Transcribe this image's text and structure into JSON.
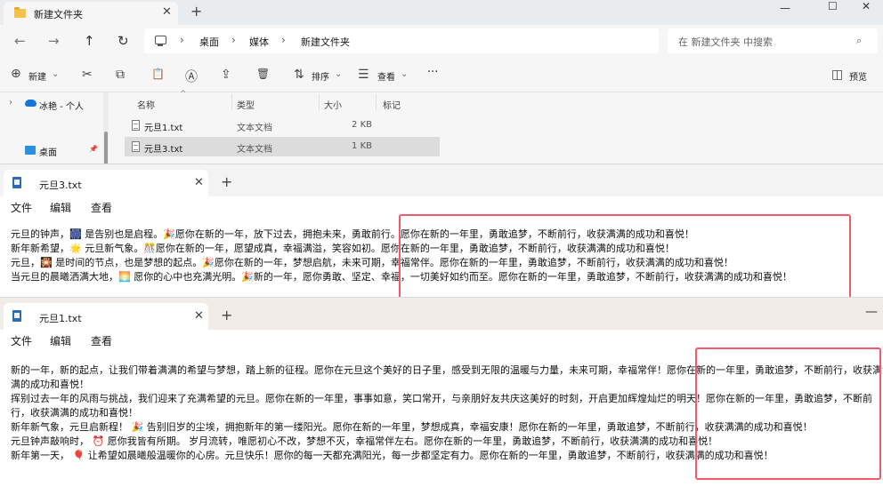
{
  "explorer": {
    "tab_title": "新建文件夹",
    "tab_close": "✕",
    "new_tab": "+",
    "window_controls": {
      "minimize": "—",
      "maximize": "☐",
      "close": "✕"
    },
    "nav": {
      "back": "←",
      "forward": "→",
      "up": "↑",
      "refresh": "↻"
    },
    "breadcrumb": [
      "桌面",
      "媒体",
      "新建文件夹"
    ],
    "crumb_sep": "›",
    "search_placeholder": "在 新建文件夹 中搜索",
    "search_icon": "⌕",
    "toolbar": {
      "new_label": "新建",
      "sort_label": "排序",
      "view_label": "查看",
      "more_label": "···",
      "preview_label": "预览",
      "icons": {
        "plus": "⊕",
        "cut": "✂",
        "copy": "⧉",
        "paste": "📋",
        "rename": "Ⓐ",
        "share": "⇪",
        "delete": "🗑",
        "sort": "⇅",
        "view": "☰",
        "preview": "◫"
      }
    },
    "sidebar": {
      "onedrive_label": "冰艳 - 个人",
      "desktop_label": "桌面",
      "expand": "›",
      "pin": "📌"
    },
    "columns": {
      "name": "名称",
      "type": "类型",
      "size": "大小",
      "tags": "标记"
    },
    "files": [
      {
        "name": "元旦1.txt",
        "type": "文本文档",
        "size": "2 KB"
      },
      {
        "name": "元旦3.txt",
        "type": "文本文档",
        "size": "1 KB"
      }
    ]
  },
  "notepad_a": {
    "tab_title": "元旦3.txt",
    "tab_close": "✕",
    "new_tab": "+",
    "menu": {
      "file": "文件",
      "edit": "编辑",
      "view": "查看"
    },
    "lines": [
      "元旦的钟声，🎆 是告别也是启程。🎉愿你在新的一年，放下过去，拥抱未来，勇敢前行。愿你在新的一年里，勇敢追梦，不断前行，收获满满的成功和喜悦！",
      "新年新希望，🌟 元旦新气象。🎊愿你在新的一年，愿望成真，幸福满溢，笑容如初。愿你在新的一年里，勇敢追梦，不断前行，收获满满的成功和喜悦！",
      "元旦，🎇 是时间的节点，也是梦想的起点。🎉愿你在新的一年，梦想启航，未来可期，幸福常伴。愿你在新的一年里，勇敢追梦，不断前行，收获满满的成功和喜悦！",
      "当元旦的晨曦洒满大地，🌅 愿你的心中也充满光明。🎉新的一年，愿你勇敢、坚定、幸福，一切美好如约而至。愿你在新的一年里，勇敢追梦，不断前行，收获满满的成功和喜悦！"
    ]
  },
  "notepad_b": {
    "tab_title": "元旦1.txt",
    "tab_close": "✕",
    "new_tab": "+",
    "minimize": "—",
    "menu": {
      "file": "文件",
      "edit": "编辑",
      "view": "查看"
    },
    "lines": [
      "新的一年，新的起点，让我们带着满满的希望与梦想，踏上新的征程。愿你在元旦这个美好的日子里，感受到无限的温暖与力量，未来可期，幸福常伴！愿你在新的一年里，勇敢追梦，不断前行，收获满满的成功和喜悦！",
      "满的成功和喜悦！",
      "挥别过去一年的风雨与挑战，我们迎来了充满希望的元旦。愿你在新的一年里，事事如意，笑口常开，与亲朋好友共庆这美好的时刻，开启更加辉煌灿烂的明天！愿你在新的一年里，勇敢追梦，不断前",
      "行，收获满满的成功和喜悦！",
      "新年新气象，元旦启新程！ 🎉 告别旧岁的尘埃，拥抱新年的第一缕阳光。愿你在新的一年里，梦想成真，幸福安康！愿你在新的一年里，勇敢追梦，不断前行，收获满满的成功和喜悦！",
      "元旦钟声敲响时， ⏰ 愿你我皆有所期。 岁月流转，唯愿初心不改，梦想不灭，幸福常伴左右。愿你在新的一年里，勇敢追梦，不断前行，收获满满的成功和喜悦！",
      "新年第一天， 🎈 让希望如晨曦般温暖你的心房。元旦快乐！愿你的每一天都充满阳光，每一步都坚定有力。愿你在新的一年里，勇敢追梦，不断前行，收获满满的成功和喜悦！"
    ]
  },
  "highlight_color": "#f05a6a"
}
